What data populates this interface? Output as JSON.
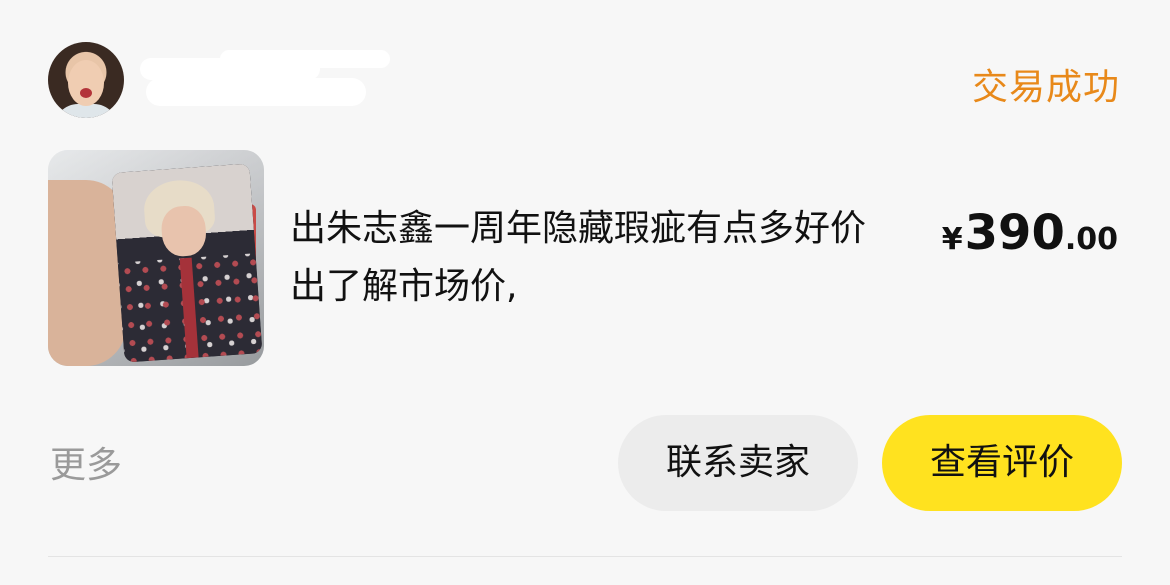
{
  "order": {
    "status": "交易成功",
    "title": "出朱志鑫一周年隐藏瑕疵有点多好价出了解市场价,",
    "price": {
      "symbol": "¥",
      "integer": "390",
      "decimal": ".00"
    }
  },
  "actions": {
    "more_label": "更多",
    "contact_label": "联系卖家",
    "review_label": "查看评价"
  },
  "colors": {
    "status": "#e8891a",
    "primary_button": "#ffe21f",
    "secondary_button": "#ececec",
    "muted_text": "#9a9a9a"
  }
}
